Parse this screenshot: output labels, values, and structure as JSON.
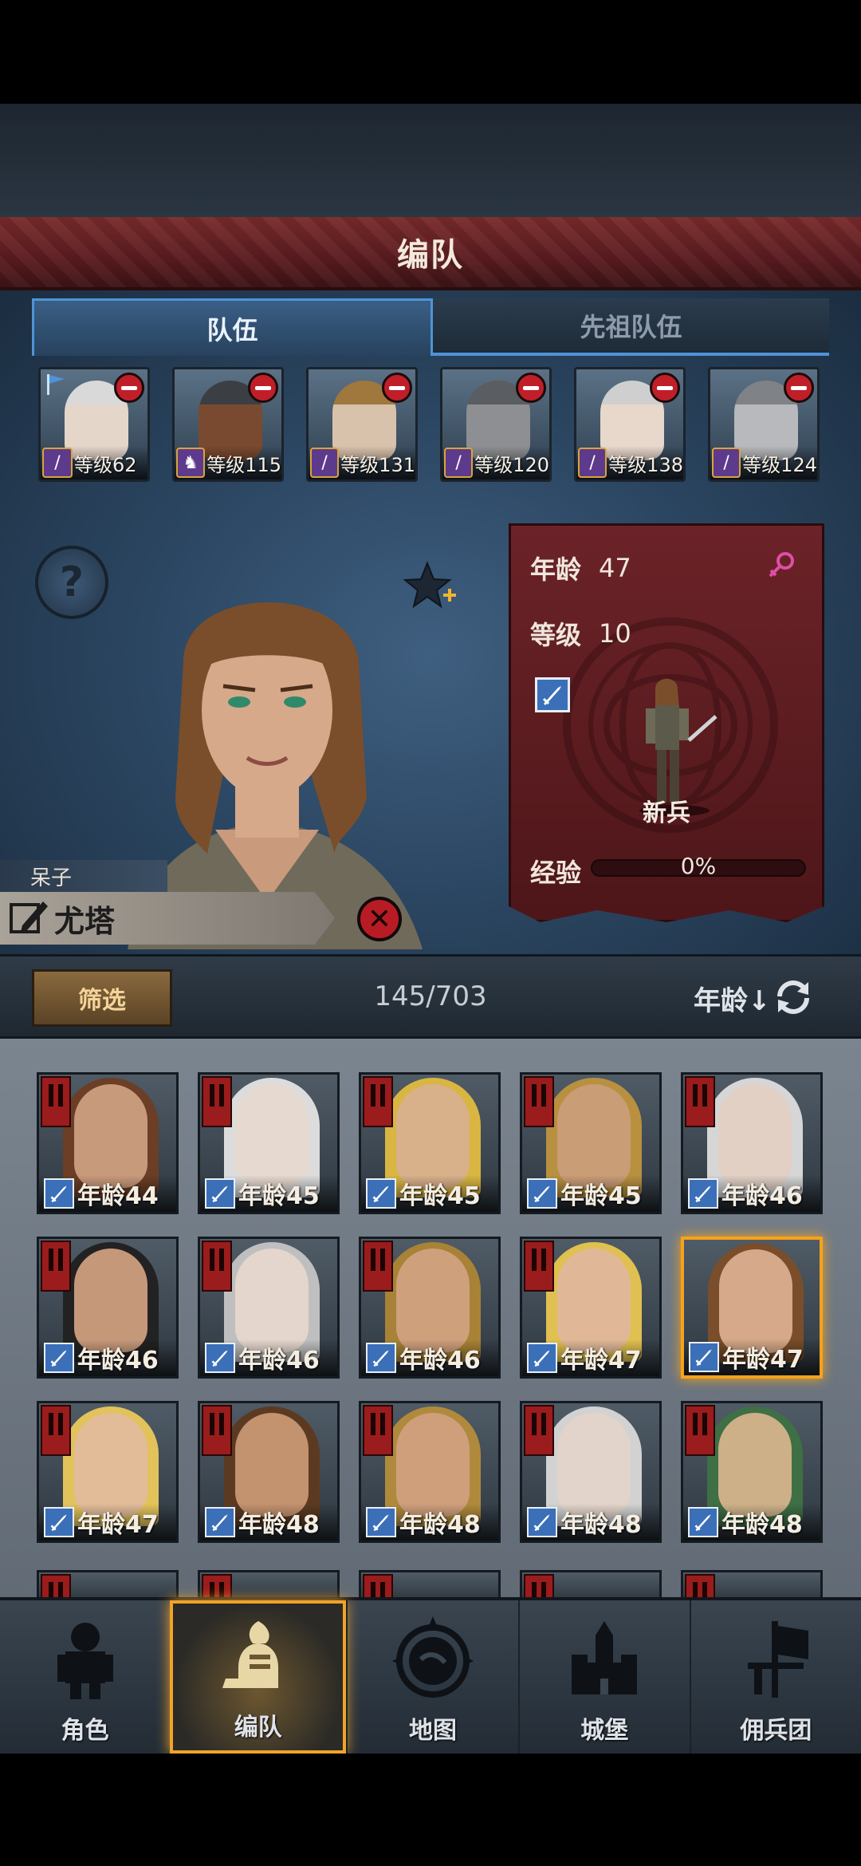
{
  "header": {
    "title": "编队"
  },
  "tabs": [
    {
      "label": "队伍",
      "active": true
    },
    {
      "label": "先祖队伍",
      "active": false
    }
  ],
  "squad": [
    {
      "level": "等级62",
      "class_icon": "staff-icon",
      "skin": "#e5d6ca",
      "hair": "#d9d9d9",
      "flag": true
    },
    {
      "level": "等级115",
      "class_icon": "horse-icon",
      "skin": "#7a4a30",
      "hair": "#3b3f44",
      "flag": false
    },
    {
      "level": "等级131",
      "class_icon": "staff-icon",
      "skin": "#d9c2ac",
      "hair": "#a0773d",
      "flag": false
    },
    {
      "level": "等级120",
      "class_icon": "staff-icon",
      "skin": "#8d8f92",
      "hair": "#5a5d61",
      "flag": false
    },
    {
      "level": "等级138",
      "class_icon": "staff-icon",
      "skin": "#e8d8cc",
      "hair": "#cfcfcf",
      "flag": false
    },
    {
      "level": "等级124",
      "class_icon": "staff-icon",
      "skin": "#b7b9bc",
      "hair": "#7f8286",
      "flag": false
    }
  ],
  "character": {
    "trait": "呆子",
    "name": "尤塔",
    "age_label": "年龄",
    "age": "47",
    "level_label": "等级",
    "level": "10",
    "gender_icon": "female-icon",
    "unit_class": "新兵",
    "exp_label": "经验",
    "exp_value": "0%",
    "exp_fraction": 0
  },
  "filter": {
    "button": "筛选",
    "count": "145/703",
    "sort": "年龄↓"
  },
  "roster": [
    {
      "age": "年龄44",
      "skin": "#c89a7c",
      "hair": "#6b3e25",
      "selected": false
    },
    {
      "age": "年龄45",
      "skin": "#e6d9cf",
      "hair": "#dcdcdc",
      "selected": false
    },
    {
      "age": "年龄45",
      "skin": "#d8b08a",
      "hair": "#d9b542",
      "selected": false
    },
    {
      "age": "年龄45",
      "skin": "#c99d76",
      "hair": "#b89040",
      "selected": false
    },
    {
      "age": "年龄46",
      "skin": "#e2d0c4",
      "hair": "#d6d6d6",
      "selected": false
    },
    {
      "age": "年龄46",
      "skin": "#c6987a",
      "hair": "#222222",
      "selected": false
    },
    {
      "age": "年龄46",
      "skin": "#e4d6cc",
      "hair": "#bfbfbf",
      "selected": false
    },
    {
      "age": "年龄46",
      "skin": "#cfa07c",
      "hair": "#a88236",
      "selected": false
    },
    {
      "age": "年龄47",
      "skin": "#e0b898",
      "hair": "#e0c050",
      "selected": false
    },
    {
      "age": "年龄47",
      "skin": "#d6a98a",
      "hair": "#7a4e2a",
      "selected": true
    },
    {
      "age": "年龄47",
      "skin": "#e2bc98",
      "hair": "#e2c25a",
      "selected": false
    },
    {
      "age": "年龄48",
      "skin": "#c3926e",
      "hair": "#5c3a22",
      "selected": false
    },
    {
      "age": "年龄48",
      "skin": "#cf9f7c",
      "hair": "#b08a3c",
      "selected": false
    },
    {
      "age": "年龄48",
      "skin": "#e2d4ca",
      "hair": "#d2d2d2",
      "selected": false
    },
    {
      "age": "年龄48",
      "skin": "#cdb088",
      "hair": "#3f6f45",
      "selected": false
    }
  ],
  "nav": [
    {
      "label": "角色",
      "icon": "knight-icon",
      "active": false
    },
    {
      "label": "编队",
      "icon": "helmet-icon",
      "active": true
    },
    {
      "label": "地图",
      "icon": "compass-map-icon",
      "active": false
    },
    {
      "label": "城堡",
      "icon": "castle-icon",
      "active": false
    },
    {
      "label": "佣兵团",
      "icon": "mercenary-banner-icon",
      "active": false
    }
  ],
  "colors": {
    "accent_blue": "#4f93d8",
    "highlight_orange": "#f7a21a",
    "banner_red": "#7a2b2c"
  }
}
